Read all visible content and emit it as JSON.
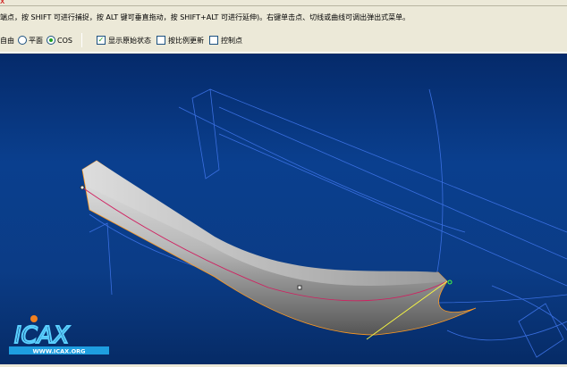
{
  "window": {
    "close_glyph": "x"
  },
  "hint": "端点，按 SHIFT 可进行捕捉，按 ALT 键可垂直拖动，按 SHIFT+ALT 可进行延伸)。右键单击点、切线或曲线可调出弹出式菜单。",
  "options": {
    "radio_free": "自由",
    "radio_plane": "平面",
    "radio_cos": "COS",
    "selected": "COS",
    "check_show_original": {
      "label": "显示原始状态",
      "checked": true
    },
    "check_proportional": {
      "label": "按比例更新",
      "checked": false
    },
    "check_control_points": {
      "label": "控制点",
      "checked": false
    }
  },
  "logo": {
    "text": "ICAX",
    "url_text": "WWW.ICAX.ORG"
  },
  "colors": {
    "panel": "#ece9d8",
    "viewport": "#0a3f8e",
    "wire": "#3a6fe0",
    "curve": "#d02060",
    "edge": "#ff9a20"
  }
}
